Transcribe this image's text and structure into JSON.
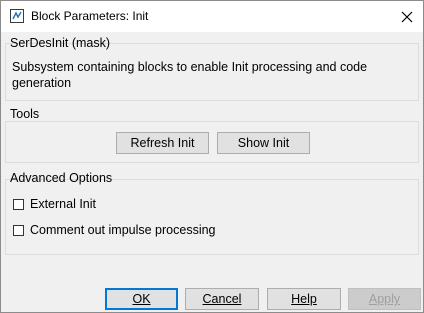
{
  "window": {
    "title": "Block Parameters: Init"
  },
  "mask_group": {
    "label": "SerDesInit (mask)",
    "description": "Subsystem containing blocks to enable Init processing and code generation"
  },
  "tools_group": {
    "label": "Tools",
    "buttons": [
      {
        "label": "Refresh Init"
      },
      {
        "label": "Show Init"
      }
    ]
  },
  "advanced_group": {
    "label": "Advanced Options",
    "checkboxes": [
      {
        "label": "External Init",
        "checked": false
      },
      {
        "label": "Comment out impulse processing",
        "checked": false
      }
    ]
  },
  "footer": {
    "ok_label": "OK",
    "cancel_label": "Cancel",
    "help_label": "Help",
    "apply_label": "Apply",
    "apply_enabled": false
  },
  "icons": {
    "app": "simulink-block-icon",
    "close": "close-icon"
  }
}
